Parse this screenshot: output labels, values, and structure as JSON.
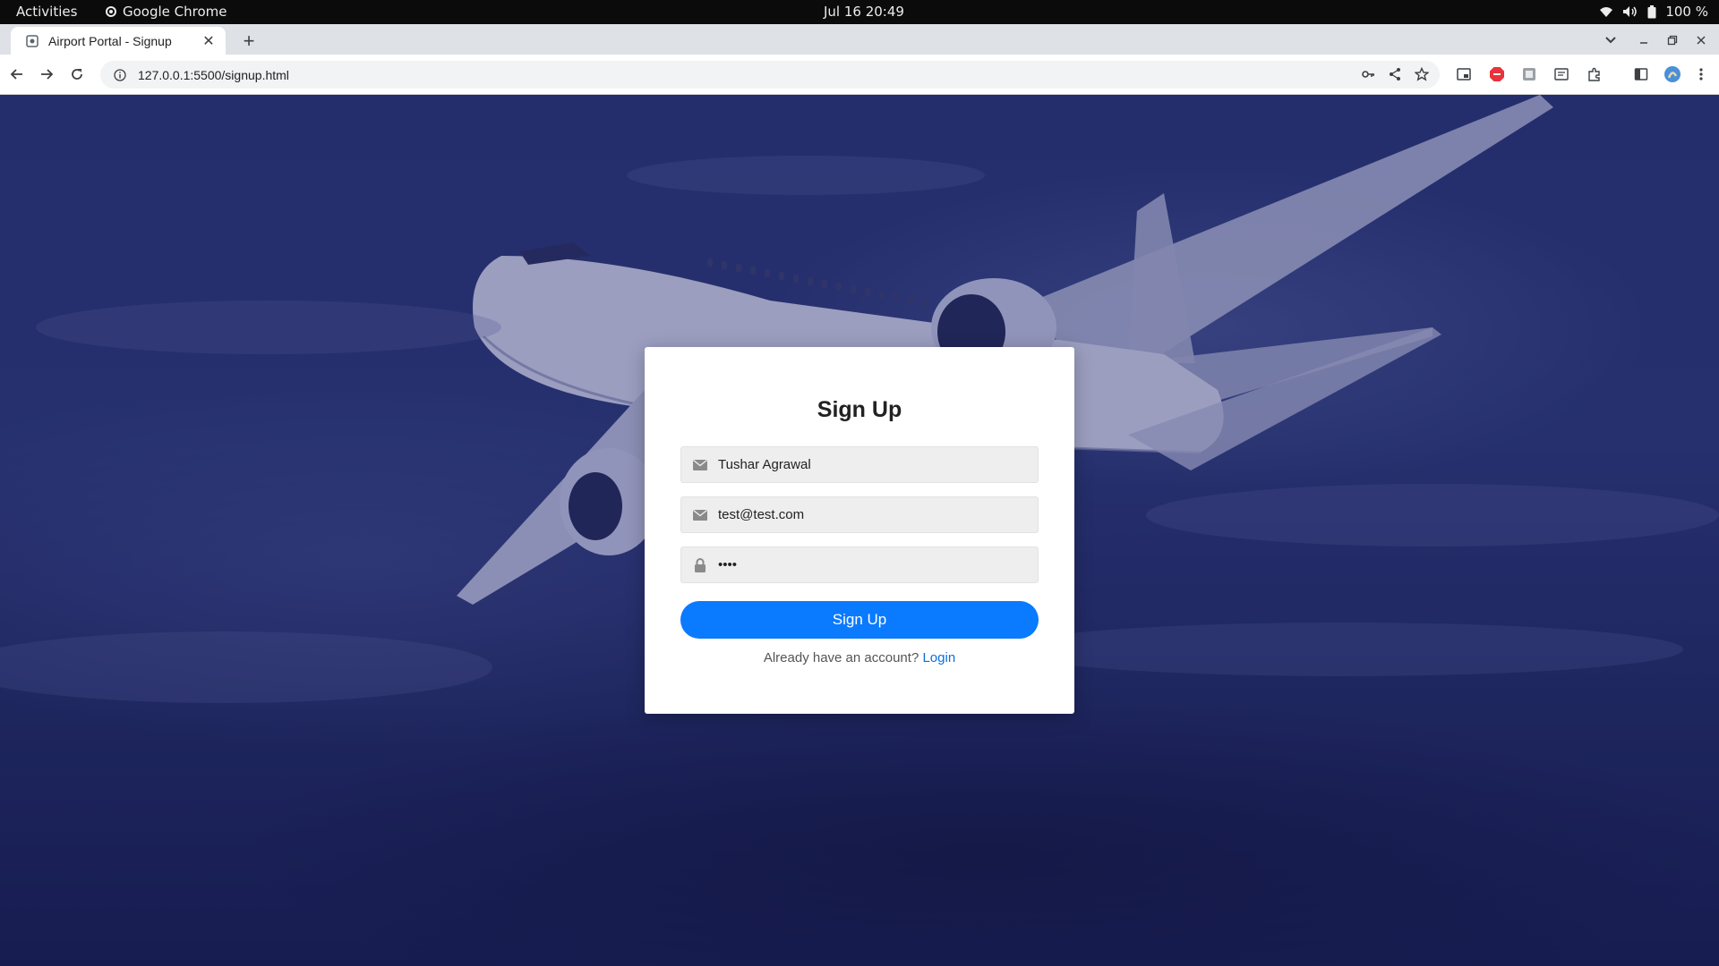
{
  "system": {
    "activities": "Activities",
    "app_name": "Google Chrome",
    "clock": "Jul 16  20:49",
    "battery": "100 %"
  },
  "browser": {
    "tab_title": "Airport Portal - Signup",
    "url": "127.0.0.1:5500/signup.html"
  },
  "form": {
    "title": "Sign Up",
    "name_value": "Tushar Agrawal",
    "email_value": "test@test.com",
    "password_value": "••••",
    "submit_label": "Sign Up",
    "switch_text": "Already have an account?",
    "switch_link": "Login"
  },
  "colors": {
    "button": "#0a7aff",
    "link": "#0a6fe0",
    "background": "#2a3570"
  }
}
